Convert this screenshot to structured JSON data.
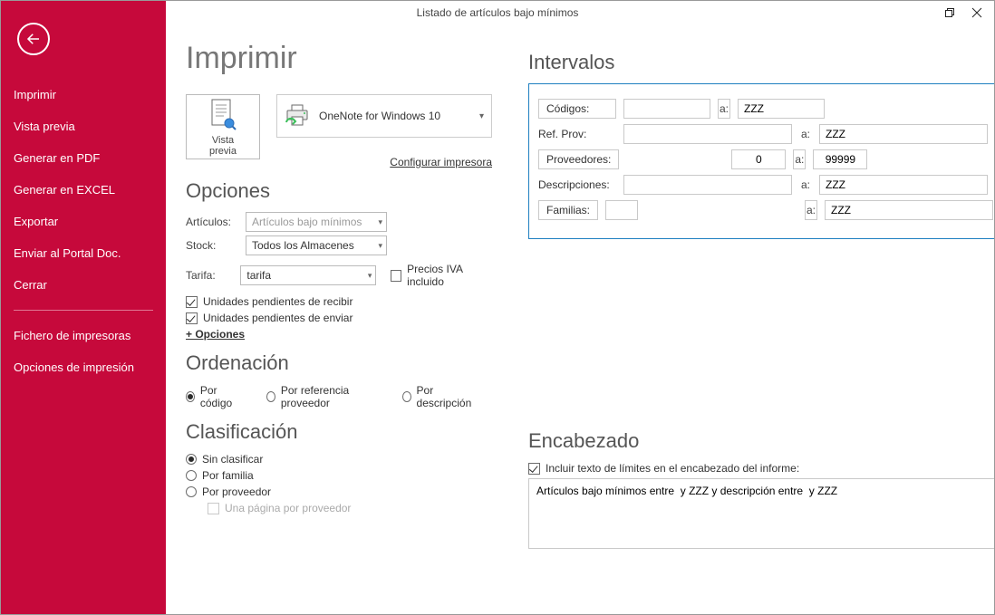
{
  "window": {
    "title": "Listado de artículos bajo mínimos"
  },
  "sidebar": {
    "items": [
      "Imprimir",
      "Vista previa",
      "Generar en PDF",
      "Generar en EXCEL",
      "Exportar",
      "Enviar al Portal Doc.",
      "Cerrar"
    ],
    "items2": [
      "Fichero de impresoras",
      "Opciones de impresión"
    ]
  },
  "page": {
    "title": "Imprimir",
    "preview_label": "Vista previa",
    "printer_name": "OneNote for Windows 10",
    "configure_printer": "Configurar impresora"
  },
  "opciones": {
    "title": "Opciones",
    "articulos_label": "Artículos:",
    "articulos_value": "Artículos bajo mínimos",
    "stock_label": "Stock:",
    "stock_value": "Todos los Almacenes",
    "tarifa_label": "Tarifa:",
    "tarifa_value": "tarifa",
    "iva_label": "Precios IVA incluido",
    "pend_recibir": "Unidades pendientes de recibir",
    "pend_enviar": "Unidades pendientes de enviar",
    "more": "+ Opciones"
  },
  "ordenacion": {
    "title": "Ordenación",
    "r1": "Por código",
    "r2": "Por referencia proveedor",
    "r3": "Por descripción"
  },
  "clasificacion": {
    "title": "Clasificación",
    "r1": "Sin clasificar",
    "r2": "Por familia",
    "r3": "Por proveedor",
    "sub": "Una página por proveedor"
  },
  "intervalos": {
    "title": "Intervalos",
    "a": "a:",
    "codigos_label": "Códigos:",
    "codigos_from": "",
    "codigos_to": "ZZZ",
    "refprov_label": "Ref. Prov:",
    "refprov_from": "",
    "refprov_to": "ZZZ",
    "prov_label": "Proveedores:",
    "prov_from": "0",
    "prov_to": "99999",
    "desc_label": "Descripciones:",
    "desc_from": "",
    "desc_to": "ZZZ",
    "fam_label": "Familias:",
    "fam_from": "",
    "fam_to": "ZZZ"
  },
  "encabezado": {
    "title": "Encabezado",
    "chk": "Incluir texto de límites en el encabezado del informe:",
    "text": "Artículos bajo mínimos entre  y ZZZ y descripción entre  y ZZZ"
  }
}
